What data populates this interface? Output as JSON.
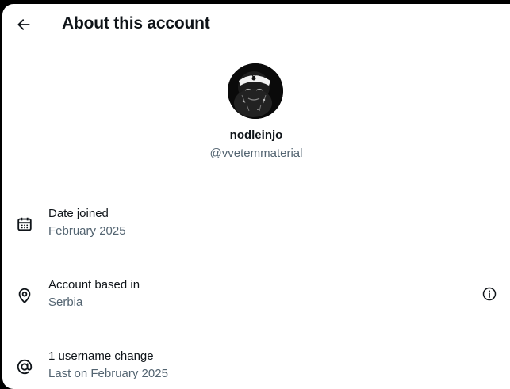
{
  "header": {
    "back_icon": "arrow-left-icon",
    "title": "About this account"
  },
  "profile": {
    "avatar_icon": "profile-avatar",
    "display_name": "nodleinjo",
    "handle": "@vvetemmaterial"
  },
  "rows": [
    {
      "icon": "calendar-icon",
      "label": "Date joined",
      "value": "February 2025"
    },
    {
      "icon": "location-pin-icon",
      "label": "Account based in",
      "value": "Serbia",
      "trailing_icon": "info-icon"
    },
    {
      "icon": "at-sign-icon",
      "label": "1 username change",
      "value": "Last on February 2025"
    }
  ],
  "colors": {
    "primary_text": "#0f1419",
    "secondary_text": "#536471",
    "background": "#ffffff",
    "frame": "#000000"
  }
}
